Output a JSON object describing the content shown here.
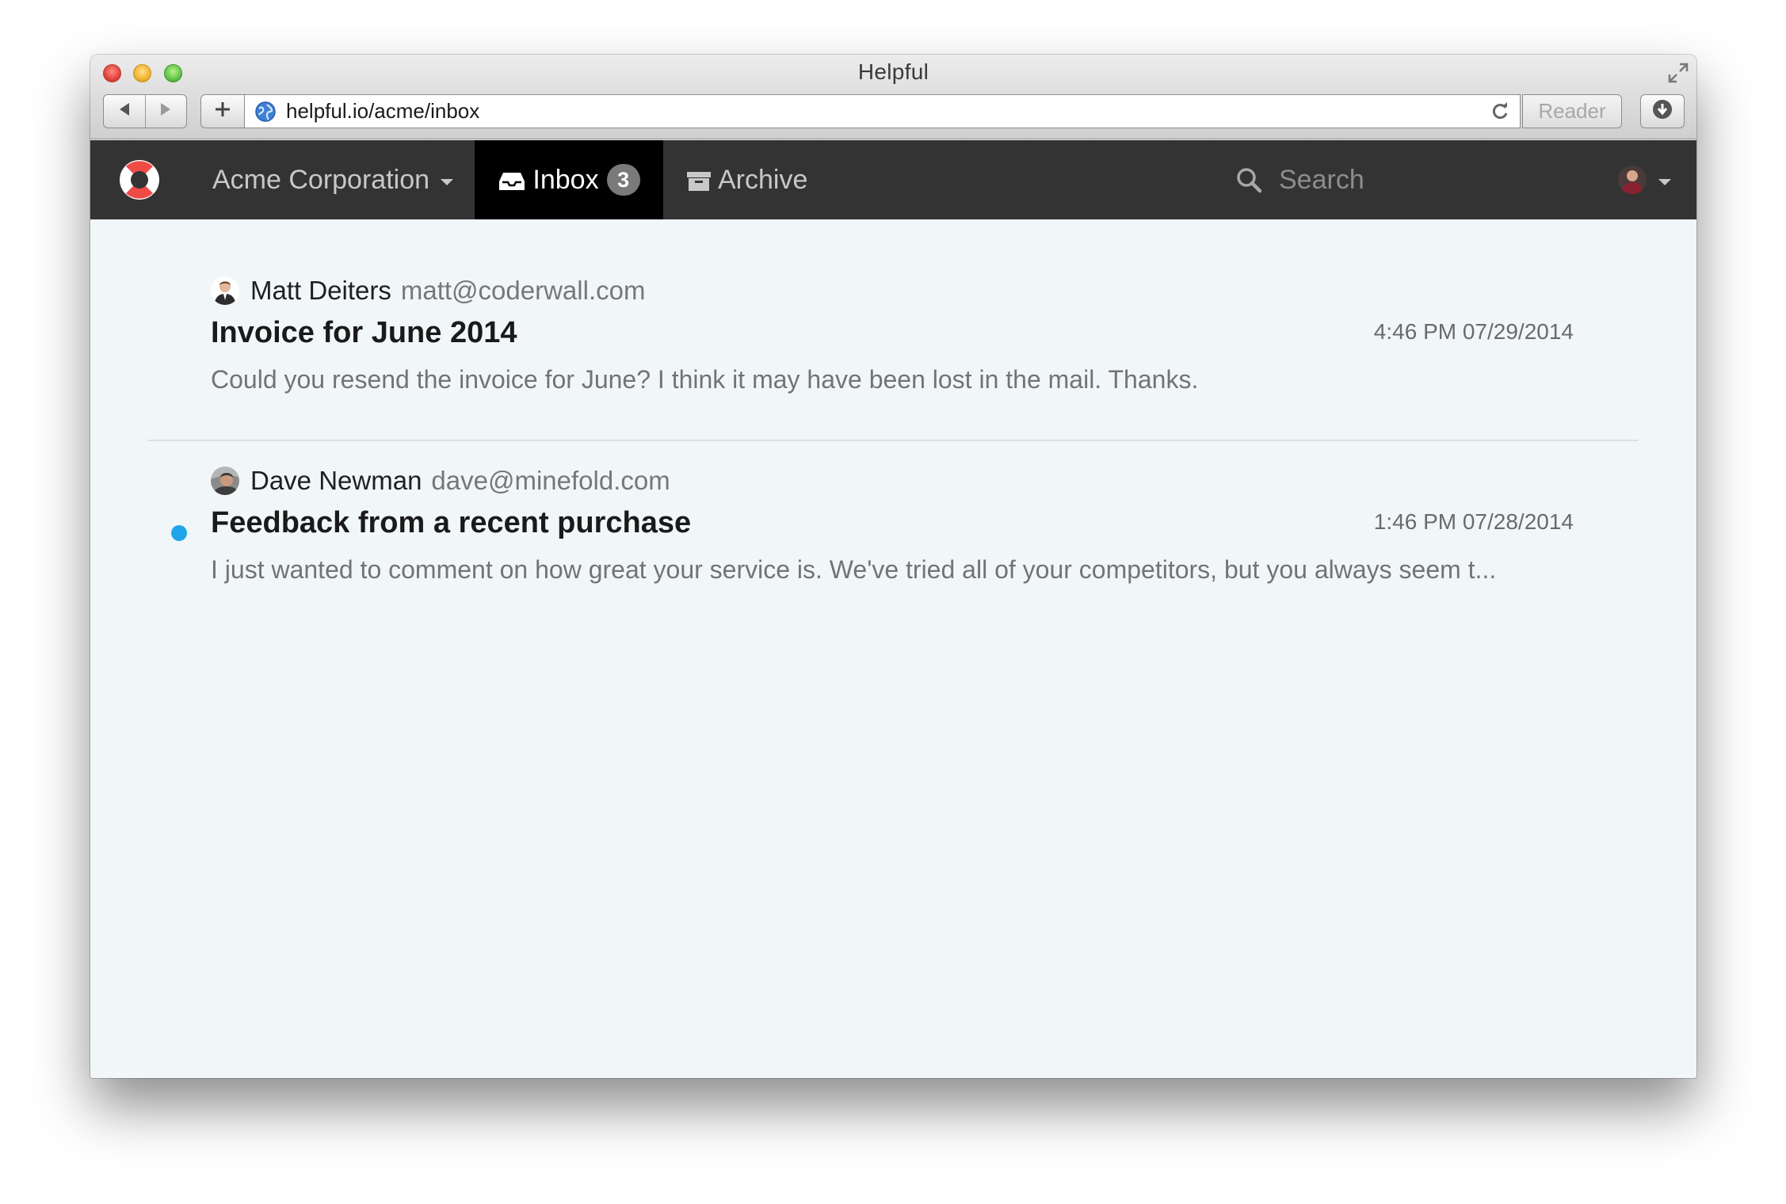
{
  "browser": {
    "title": "Helpful",
    "url": "helpful.io/acme/inbox",
    "reader_label": "Reader"
  },
  "navbar": {
    "organization": "Acme Corporation",
    "tabs": [
      {
        "label": "Inbox",
        "badge": "3",
        "icon": "inbox-icon",
        "active": true
      },
      {
        "label": "Archive",
        "icon": "archive-icon",
        "active": false
      }
    ],
    "search_placeholder": "Search"
  },
  "conversations": [
    {
      "sender_name": "Matt Deiters",
      "sender_email": "matt@coderwall.com",
      "subject": "Invoice for June 2014",
      "timestamp": "4:46 PM 07/29/2014",
      "preview": "Could you resend the invoice for June? I think it may have been lost in the mail. Thanks.",
      "unread": false
    },
    {
      "sender_name": "Dave Newman",
      "sender_email": "dave@minefold.com",
      "subject": "Feedback from a recent purchase",
      "timestamp": "1:46 PM 07/28/2014",
      "preview": "I just wanted to comment on how great your service is. We've tried all of your competitors, but you always seem t...",
      "unread": true
    }
  ],
  "colors": {
    "navbar_bg": "#333333",
    "active_tab_bg": "#000000",
    "content_bg": "#f1f7f9",
    "unread_dot": "#1fa6ea",
    "logo_red": "#f04a45"
  }
}
